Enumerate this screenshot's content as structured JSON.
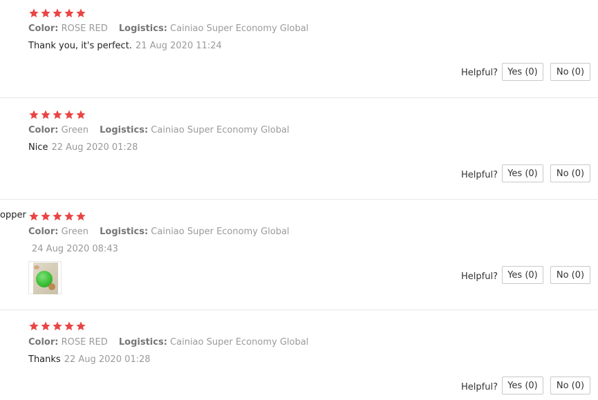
{
  "accent_star_color": "#e94545",
  "labels": {
    "color_key": "Color:",
    "logistics_key": "Logistics:",
    "helpful": "Helpful?"
  },
  "reviews": [
    {
      "user": "",
      "stars": 5,
      "color": "ROSE RED",
      "logistics": "Cainiao Super Economy Global",
      "text": "Thank you, it's perfect.",
      "date": "21 Aug 2020 11:24",
      "yes": "Yes (0)",
      "no": "No (0)"
    },
    {
      "user": "",
      "stars": 5,
      "color": "Green",
      "logistics": "Cainiao Super Economy Global",
      "text": "Nice",
      "date": "22 Aug 2020 01:28",
      "yes": "Yes (0)",
      "no": "No (0)"
    },
    {
      "user": "opper",
      "stars": 5,
      "color": "Green",
      "logistics": "Cainiao Super Economy Global",
      "text": "",
      "date": "24 Aug 2020 08:43",
      "has_photo": true,
      "yes": "Yes (0)",
      "no": "No (0)"
    },
    {
      "user": "",
      "stars": 5,
      "color": "ROSE RED",
      "logistics": "Cainiao Super Economy Global",
      "text": "Thanks",
      "date": "22 Aug 2020 01:28",
      "yes": "Yes (0)",
      "no": "No (0)"
    }
  ]
}
